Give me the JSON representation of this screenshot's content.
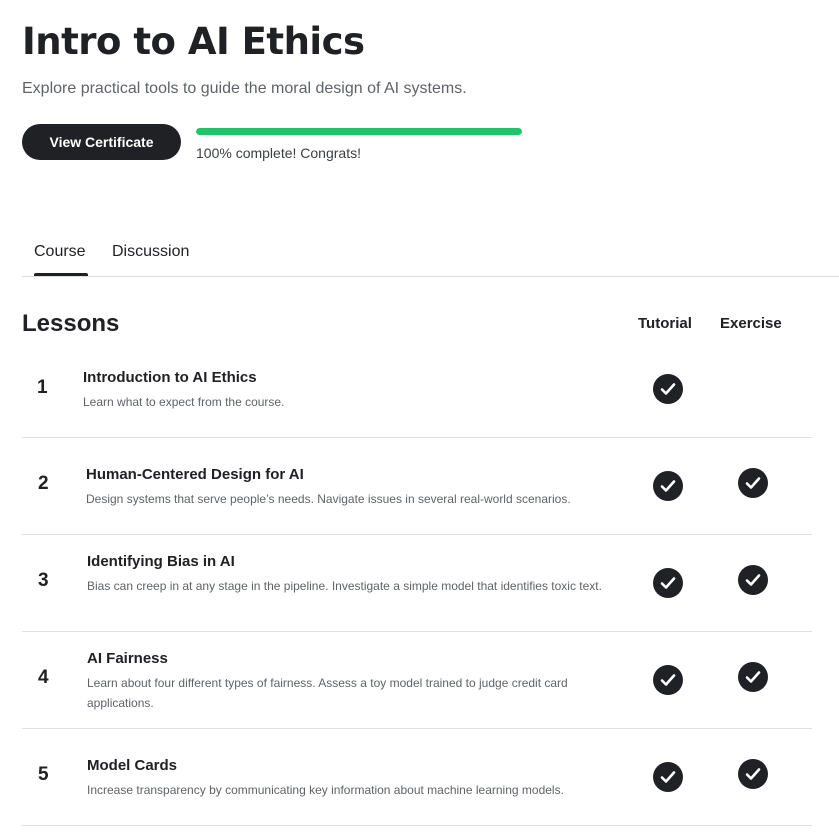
{
  "header": {
    "title": "Intro to AI Ethics",
    "subtitle": "Explore practical tools to guide the moral design of AI systems.",
    "certificate_button": "View Certificate",
    "progress_percent": 100,
    "progress_text": "100% complete! Congrats!",
    "progress_color": "#1ec46a"
  },
  "tabs": {
    "course": "Course",
    "discussion": "Discussion",
    "active": "Course"
  },
  "lessons": {
    "heading": "Lessons",
    "col_tutorial": "Tutorial",
    "col_exercise": "Exercise",
    "items": [
      {
        "number": "1",
        "title": "Introduction to AI Ethics",
        "description": "Learn what to expect from the course.",
        "tutorial_done": true,
        "exercise_done": false
      },
      {
        "number": "2",
        "title": "Human-Centered Design for AI",
        "description": "Design systems that serve people’s needs. Navigate issues in several real-world scenarios.",
        "tutorial_done": true,
        "exercise_done": true
      },
      {
        "number": "3",
        "title": "Identifying Bias in AI",
        "description": "Bias can creep in at any stage in the pipeline. Investigate a simple model that identifies toxic text.",
        "tutorial_done": true,
        "exercise_done": true
      },
      {
        "number": "4",
        "title": "AI Fairness",
        "description": "Learn about four different types of fairness. Assess a toy model trained to judge credit card applications.",
        "tutorial_done": true,
        "exercise_done": true
      },
      {
        "number": "5",
        "title": "Model Cards",
        "description": "Increase transparency by communicating key information about machine learning models.",
        "tutorial_done": true,
        "exercise_done": true
      }
    ]
  }
}
